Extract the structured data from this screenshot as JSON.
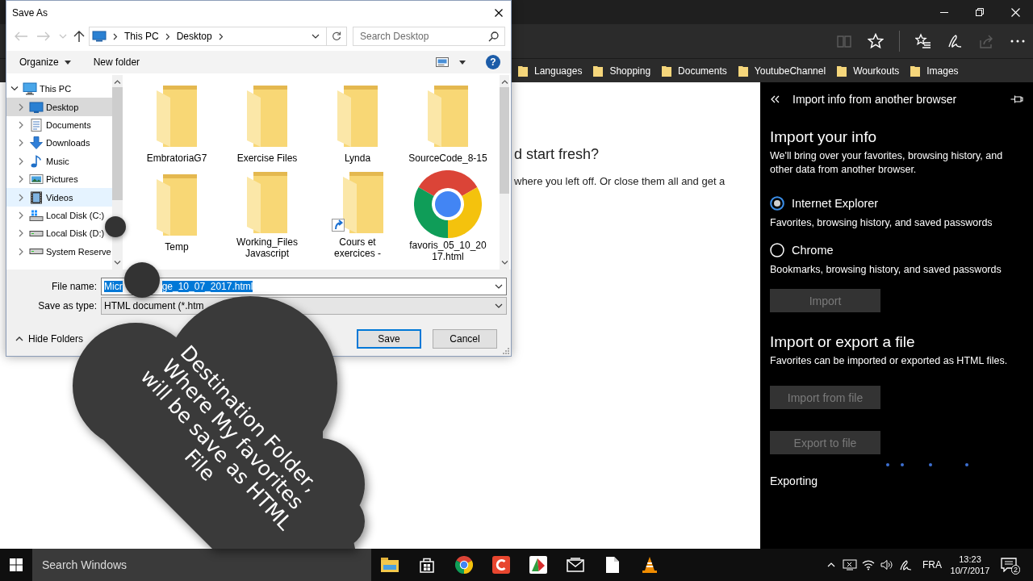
{
  "save_dialog": {
    "title": "Save As",
    "nav_buttons": [
      {
        "kind": "back",
        "disabled": true
      },
      {
        "kind": "forward",
        "disabled": true
      },
      {
        "kind": "recent",
        "disabled": true
      },
      {
        "kind": "up",
        "disabled": false
      }
    ],
    "breadcrumb": [
      "This PC",
      "Desktop"
    ],
    "search": {
      "placeholder": "Search Desktop"
    },
    "toolbar": {
      "organize": "Organize",
      "new_folder": "New folder",
      "help": "?"
    },
    "tree": [
      {
        "label": "This PC",
        "kind": "pc",
        "expanded": true,
        "selected": false,
        "hovered": false,
        "children": [
          {
            "label": "Desktop",
            "kind": "desktop",
            "expanded": false,
            "selected": true,
            "hovered": false
          },
          {
            "label": "Documents",
            "kind": "documents",
            "expanded": false,
            "selected": false,
            "hovered": false
          },
          {
            "label": "Downloads",
            "kind": "downloads",
            "expanded": false,
            "selected": false,
            "hovered": false
          },
          {
            "label": "Music",
            "kind": "music",
            "expanded": false,
            "selected": false,
            "hovered": false
          },
          {
            "label": "Pictures",
            "kind": "pictures",
            "expanded": false,
            "selected": false,
            "hovered": false
          },
          {
            "label": "Videos",
            "kind": "videos",
            "expanded": false,
            "selected": false,
            "hovered": true
          },
          {
            "label": "Local Disk (C:)",
            "kind": "system-disk",
            "expanded": false,
            "selected": false,
            "hovered": false
          },
          {
            "label": "Local Disk (D:)",
            "kind": "disk",
            "expanded": false,
            "selected": false,
            "hovered": false
          },
          {
            "label": "System Reserve",
            "kind": "disk",
            "expanded": false,
            "selected": false,
            "hovered": false
          }
        ]
      }
    ],
    "files": [
      {
        "name": "EmbratoriaG7",
        "kind": "folder"
      },
      {
        "name": "Exercise Files",
        "kind": "folder"
      },
      {
        "name": "Lynda",
        "kind": "folder"
      },
      {
        "name": "SourceCode_8-15",
        "kind": "folder"
      },
      {
        "name": "Temp",
        "kind": "folder"
      },
      {
        "name": "Working_Files Javascript",
        "kind": "folder"
      },
      {
        "name": "Cours et exercices -",
        "kind": "shortcut"
      },
      {
        "name": "favoris_05_10_2017.html",
        "kind": "html"
      }
    ],
    "file_name": {
      "label": "File name:",
      "value_parts": [
        "Micr",
        "ge_10_07_2017.html"
      ],
      "text_selected": true
    },
    "save_as_type": {
      "label": "Save as type:",
      "value": "HTML document (*.htm"
    },
    "hide_folders": "Hide Folders",
    "buttons": [
      {
        "label": "Save",
        "default": true
      },
      {
        "label": "Cancel",
        "default": false
      }
    ]
  },
  "browser": {
    "toolbar": [
      {
        "kind": "book",
        "disabled": true
      },
      {
        "kind": "star",
        "disabled": false
      },
      {
        "kind": "hub",
        "disabled": false
      },
      {
        "kind": "pen",
        "disabled": false
      },
      {
        "kind": "share",
        "disabled": true
      },
      {
        "kind": "more",
        "disabled": false
      }
    ],
    "favorites": [
      "Languages",
      "Shopping",
      "Documents",
      "YoutubeChannel",
      "Wourkouts",
      "Images"
    ],
    "page": {
      "heading": "d start fresh?",
      "text": "where you left off. Or close them all and get a"
    },
    "panel": {
      "title": "Import info from another browser",
      "import_heading": "Import your info",
      "import_description": "We'll bring over your favorites, browsing history, and other data from another browser.",
      "browsers": [
        {
          "name": "Internet Explorer",
          "description": "Favorites, browsing history, and saved passwords",
          "selected": true
        },
        {
          "name": "Chrome",
          "description": "Bookmarks, browsing history, and saved passwords",
          "selected": false
        }
      ],
      "import_button": {
        "label": "Import",
        "disabled": true
      },
      "file_heading": "Import or export a file",
      "file_description": "Favorites can be imported or exported as HTML files.",
      "file_buttons": [
        {
          "label": "Import from file",
          "disabled": true
        },
        {
          "label": "Export to file",
          "disabled": true
        }
      ],
      "status": "Exporting"
    }
  },
  "callout": {
    "lines": [
      "Destination Folder,",
      "Where My favorites",
      "will be save as HTML",
      "File"
    ]
  },
  "taskbar": {
    "search_placeholder": "Search Windows",
    "language": "FRA",
    "time": "13:23",
    "date": "10/7/2017",
    "notifications": "2"
  }
}
